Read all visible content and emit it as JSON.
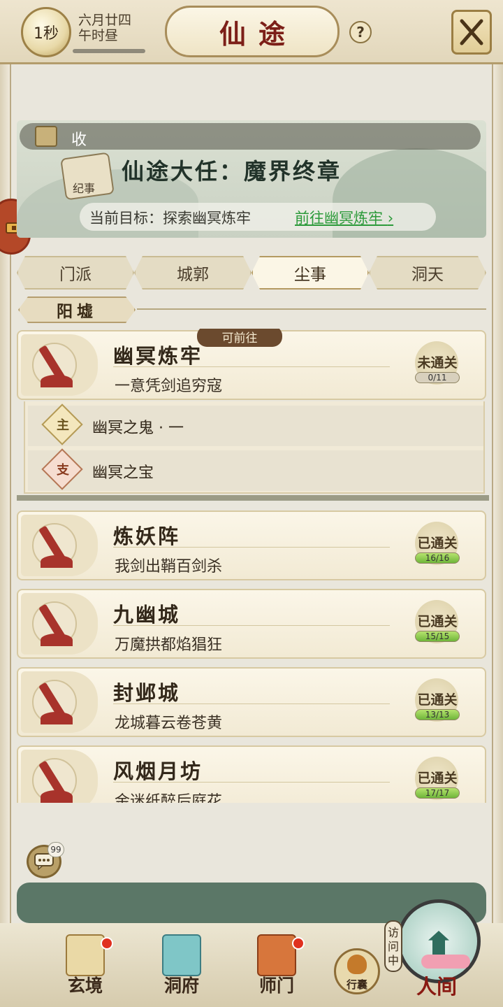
{
  "header": {
    "timer": "1秒",
    "date_line1": "六月廿四",
    "date_line2": "午时昼",
    "title": "仙途",
    "help_label": "?"
  },
  "banner": {
    "tag_label": "收",
    "scroll_label": "纪事",
    "quest_title": "仙途大任：魔界终章",
    "goal_text": "当前目标：探索幽冥炼牢",
    "goal_link": "前往幽冥炼牢"
  },
  "tabs": [
    "门派",
    "城郭",
    "尘事",
    "洞天"
  ],
  "active_tab": "尘事",
  "section": {
    "title": "阳墟"
  },
  "cards": [
    {
      "name": "幽冥炼牢",
      "subtitle": "一意凭剑追穷寇",
      "status": "未通关",
      "progress": "0/11",
      "tag": "可前往",
      "sub_items": [
        {
          "badge": "主",
          "label": "幽冥之鬼 · 一"
        },
        {
          "badge": "支",
          "label": "幽冥之宝"
        }
      ]
    },
    {
      "name": "炼妖阵",
      "subtitle": "我剑出鞘百剑杀",
      "status": "已通关",
      "progress": "16/16"
    },
    {
      "name": "九幽城",
      "subtitle": "万魔拱都焰猖狂",
      "status": "已通关",
      "progress": "15/15"
    },
    {
      "name": "封邺城",
      "subtitle": "龙城暮云卷苍黄",
      "status": "已通关",
      "progress": "13/13"
    },
    {
      "name": "风烟月坊",
      "subtitle": "金迷纸醉后庭花",
      "status": "已通关",
      "progress": "17/17"
    }
  ],
  "chat": {
    "count": "99"
  },
  "dock": {
    "items": [
      "玄境",
      "洞府",
      "师门"
    ],
    "bag_label": "行囊",
    "visit_label": "访问中",
    "world_label": "人间"
  }
}
